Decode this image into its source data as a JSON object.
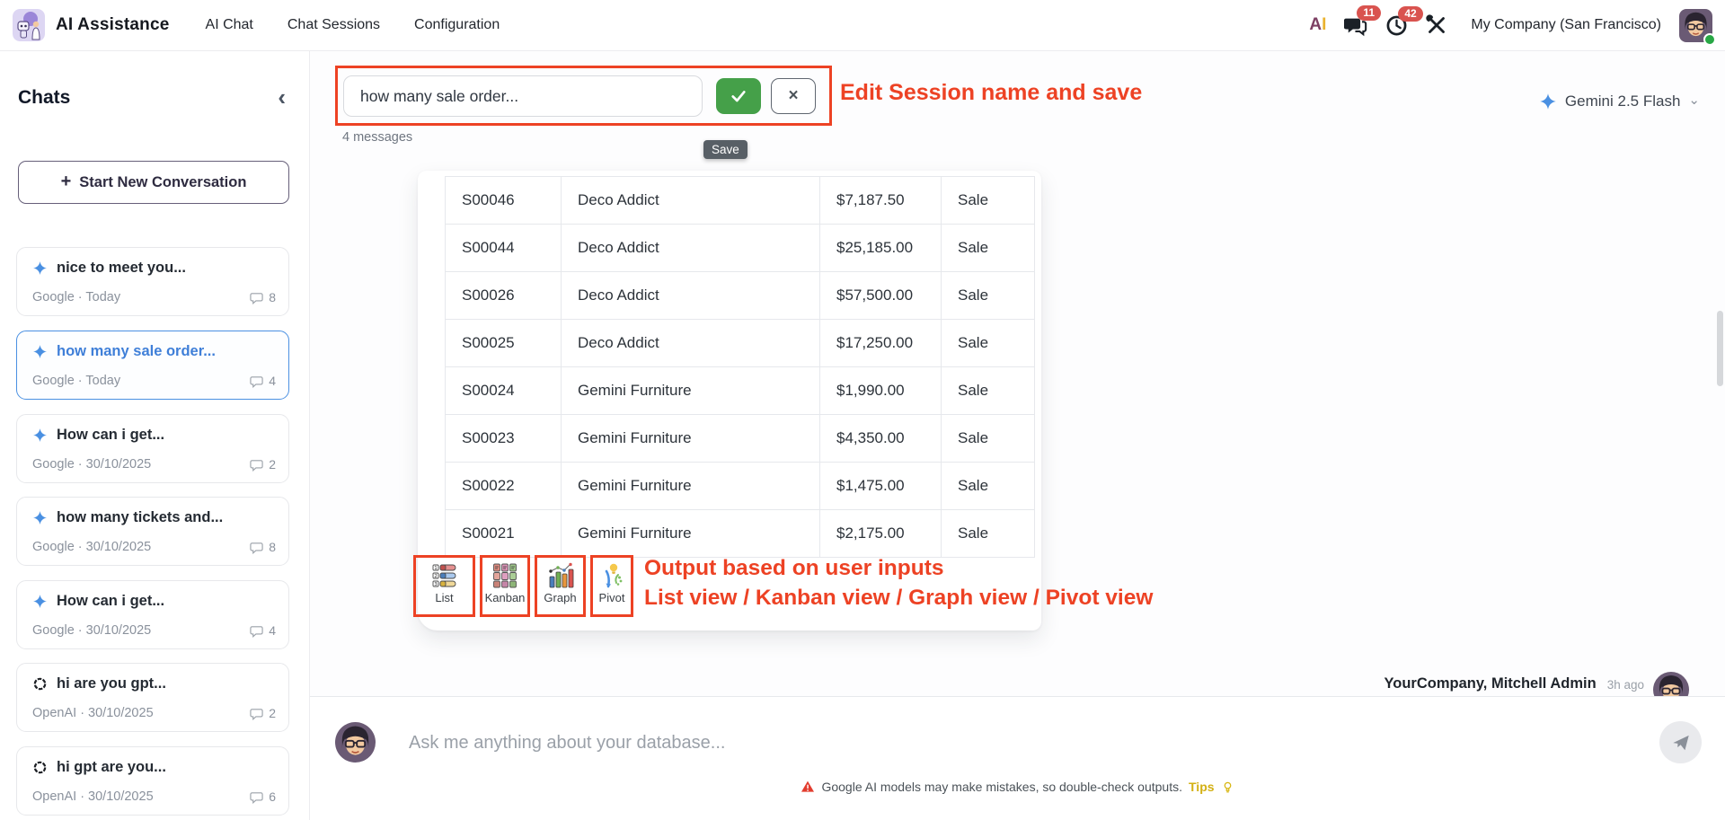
{
  "navbar": {
    "app_title": "AI Assistance",
    "menu": [
      "AI Chat",
      "Chat Sessions",
      "Configuration"
    ],
    "ai_mark": {
      "a": "A",
      "i": "I"
    },
    "messages_badge": "11",
    "activities_badge": "42",
    "company": "My Company (San Francisco)"
  },
  "sidebar": {
    "title": "Chats",
    "collapse_glyph": "‹",
    "new_conversation": "Start New Conversation",
    "plus_glyph": "+",
    "chats": [
      {
        "title": "nice to meet you...",
        "meta": "Google · Today",
        "count": "8",
        "provider": "google"
      },
      {
        "title": "how many sale order...",
        "meta": "Google · Today",
        "count": "4",
        "provider": "google",
        "active": true
      },
      {
        "title": "How can i get...",
        "meta": "Google · 30/10/2025",
        "count": "2",
        "provider": "google"
      },
      {
        "title": "how many tickets and...",
        "meta": "Google · 30/10/2025",
        "count": "8",
        "provider": "google"
      },
      {
        "title": "How can i get...",
        "meta": "Google · 30/10/2025",
        "count": "4",
        "provider": "google"
      },
      {
        "title": "hi are you gpt...",
        "meta": "OpenAI · 30/10/2025",
        "count": "2",
        "provider": "openai"
      },
      {
        "title": "hi gpt are you...",
        "meta": "OpenAI · 30/10/2025",
        "count": "6",
        "provider": "openai"
      }
    ]
  },
  "session": {
    "name_value": "how many sale order...",
    "messages_count": "4 messages",
    "close_glyph": "×",
    "save_tooltip": "Save",
    "annotation": "Edit Session name and save"
  },
  "model_selector": {
    "label": "Gemini 2.5 Flash",
    "dropdown_glyph": "⌄"
  },
  "result_table": {
    "rows": [
      [
        "S00046",
        "Deco Addict",
        "$7,187.50",
        "Sale"
      ],
      [
        "S00044",
        "Deco Addict",
        "$25,185.00",
        "Sale"
      ],
      [
        "S00026",
        "Deco Addict",
        "$57,500.00",
        "Sale"
      ],
      [
        "S00025",
        "Deco Addict",
        "$17,250.00",
        "Sale"
      ],
      [
        "S00024",
        "Gemini Furniture",
        "$1,990.00",
        "Sale"
      ],
      [
        "S00023",
        "Gemini Furniture",
        "$4,350.00",
        "Sale"
      ],
      [
        "S00022",
        "Gemini Furniture",
        "$1,475.00",
        "Sale"
      ],
      [
        "S00021",
        "Gemini Furniture",
        "$2,175.00",
        "Sale"
      ]
    ]
  },
  "views": {
    "buttons": [
      {
        "label": "List"
      },
      {
        "label": "Kanban"
      },
      {
        "label": "Graph"
      },
      {
        "label": "Pivot"
      }
    ],
    "annotation_line1": "Output based on user inputs",
    "annotation_line2": "List view / Kanban view / Graph view / Pivot view"
  },
  "last_message": {
    "author": "YourCompany, Mitchell Admin",
    "time": "3h ago"
  },
  "composer": {
    "placeholder": "Ask me anything about your database...",
    "disclaimer": "Google AI models may make mistakes, so double-check outputs.",
    "tips_label": "Tips"
  },
  "colors": {
    "annotation_red": "#ed4224",
    "accent_blue": "#4a90e2",
    "badge_red": "#d9534f",
    "success_green": "#45a049"
  }
}
